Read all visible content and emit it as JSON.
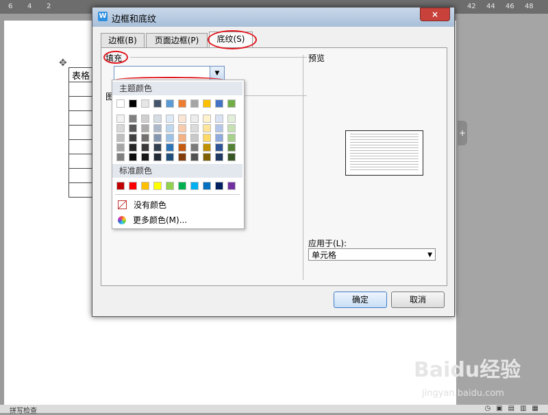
{
  "ruler": {
    "left_ticks": [
      "6",
      "4",
      "2"
    ],
    "right_ticks": [
      "42",
      "44",
      "46",
      "48"
    ]
  },
  "document": {
    "table_header": "表格",
    "statusbar_text": "拼写检查"
  },
  "watermark": {
    "brand": "Baidu经验",
    "url": "jingyan.baidu.com"
  },
  "dialog": {
    "title": "边框和底纹",
    "close_label": "×",
    "tabs": [
      {
        "label": "边框(B)"
      },
      {
        "label": "页面边框(P)"
      },
      {
        "label": "底纹(S)"
      }
    ],
    "fill_label": "填充",
    "pattern_label": "图",
    "preview_label": "预览",
    "apply_label": "应用于(L):",
    "apply_value": "单元格",
    "ok_label": "确定",
    "cancel_label": "取消"
  },
  "color_dropdown": {
    "theme_label": "主题颜色",
    "standard_label": "标准颜色",
    "theme_top": [
      "#ffffff",
      "#000000",
      "#e7e6e6",
      "#44546a",
      "#5b9bd5",
      "#ed7d31",
      "#a5a5a5",
      "#ffc000",
      "#4472c4",
      "#70ad47"
    ],
    "theme_shades": [
      [
        "#f2f2f2",
        "#808080",
        "#d0cece",
        "#d6dce4",
        "#deebf6",
        "#fbe5d5",
        "#ededed",
        "#fff2cc",
        "#dae3f3",
        "#e2efd9"
      ],
      [
        "#d8d8d8",
        "#595959",
        "#aeaaaa",
        "#adb9ca",
        "#bdd7ee",
        "#f7cbac",
        "#dbdbdb",
        "#fee599",
        "#b4c6e7",
        "#c5e0b3"
      ],
      [
        "#bfbfbf",
        "#404040",
        "#747070",
        "#8496b0",
        "#9cc3e5",
        "#f4b183",
        "#c9c9c9",
        "#ffd965",
        "#8faadc",
        "#a8d08d"
      ],
      [
        "#a5a5a5",
        "#262626",
        "#3a3838",
        "#323f4f",
        "#2e75b5",
        "#c55a11",
        "#7b7b7b",
        "#bf9000",
        "#2f5496",
        "#538135"
      ],
      [
        "#7f7f7f",
        "#0d0d0d",
        "#171616",
        "#222a35",
        "#1e4e79",
        "#833c0b",
        "#525252",
        "#7f6000",
        "#1f3864",
        "#375623"
      ]
    ],
    "standard": [
      "#c00000",
      "#ff0000",
      "#ffc000",
      "#ffff00",
      "#92d050",
      "#00b050",
      "#00b0f0",
      "#0070c0",
      "#002060",
      "#7030a0"
    ],
    "no_color_label": "没有颜色",
    "more_colors_label": "更多颜色(M)..."
  },
  "annotation_color": "#e0141c"
}
